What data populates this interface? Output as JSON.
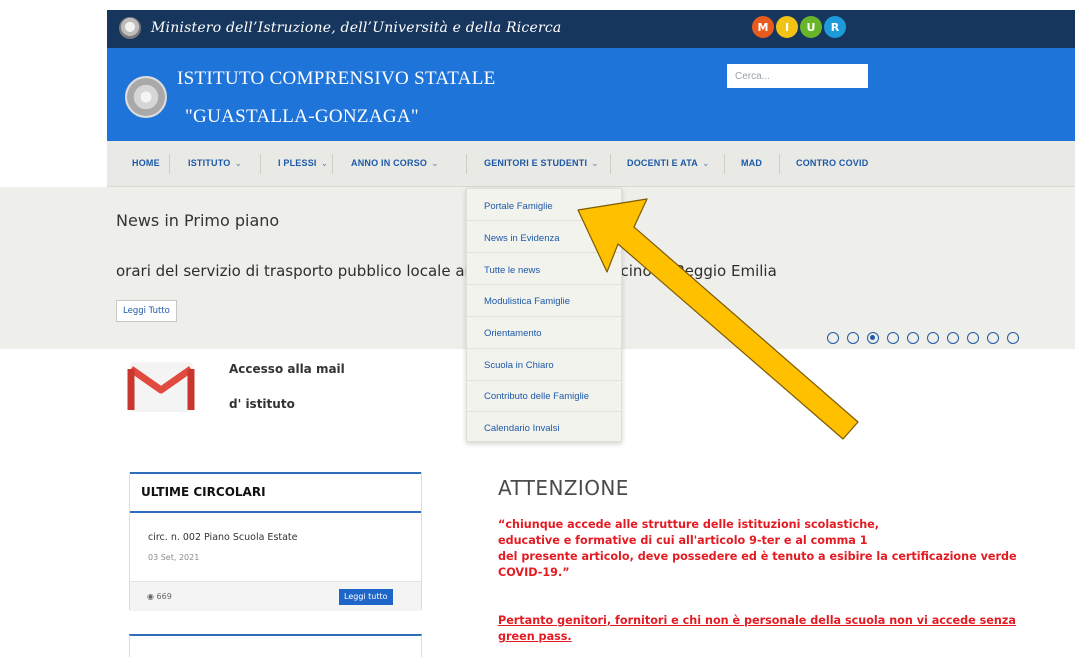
{
  "topbar": {
    "ministry": "Ministero dell’Istruzione, dell’Università e della Ricerca",
    "logo_letters": [
      "M",
      "I",
      "U",
      "R"
    ]
  },
  "header": {
    "school_line1": "ISTITUTO COMPRENSIVO STATALE",
    "school_line2": "\"GUASTALLA-GONZAGA\"",
    "search_placeholder": "Cerca..."
  },
  "nav": [
    {
      "label": "HOME"
    },
    {
      "label": "ISTITUTO"
    },
    {
      "label": "I PLESSI"
    },
    {
      "label": "ANNO IN CORSO"
    },
    {
      "label": "GENITORI E STUDENTI"
    },
    {
      "label": "DOCENTI E ATA"
    },
    {
      "label": "MAD"
    },
    {
      "label": "CONTRO COVID"
    }
  ],
  "dropdown": [
    {
      "label": "Portale Famiglie"
    },
    {
      "label": "News in Evidenza"
    },
    {
      "label": "Tutte le news"
    },
    {
      "label": "Modulistica Famiglie"
    },
    {
      "label": "Orientamento"
    },
    {
      "label": "Scuola in Chiaro"
    },
    {
      "label": "Contributo delle Famiglie"
    },
    {
      "label": "Calendario Invalsi"
    }
  ],
  "slider": {
    "title": "News in Primo piano",
    "text": "orari del servizio di trasporto pubblico locale anno 2021 2022 di bacino di Reggio Emilia",
    "read_more": "Leggi Tutto",
    "slide_count": 10,
    "active_slide": 3
  },
  "mail": {
    "line1": "Accesso  alla mail",
    "line2": "d' istituto"
  },
  "circolari": {
    "heading": "ULTIME CIRCOLARI",
    "title": "circ. n. 002 Piano Scuola Estate",
    "date": "03 Set, 2021",
    "views": "669",
    "button": "Leggi tutto"
  },
  "attenzione": {
    "title": "ATTENZIONE",
    "body_lines": [
      " “chiunque  accede alle strutture delle istituzioni scolastiche,",
      "educative  e  formative di cui all'articolo 9-ter e al comma 1",
      "del  presente  articolo,  deve possedere ed è tenuto a esibire la certificazione verde",
      "COVID-19.”"
    ],
    "link_lines": [
      "Pertanto genitori, fornitori e chi non è personale della scuola non vi accede senza",
      "green pass."
    ]
  },
  "colors": {
    "topbar": "#17365d",
    "header_blue": "#1f74d9",
    "nav_text": "#1d58a7",
    "alert_red": "#e31b23",
    "arrow_yellow": "#ffc000",
    "miur_colors": [
      "#e85b1f",
      "#f0c315",
      "#69b529",
      "#1d9ad9"
    ]
  }
}
